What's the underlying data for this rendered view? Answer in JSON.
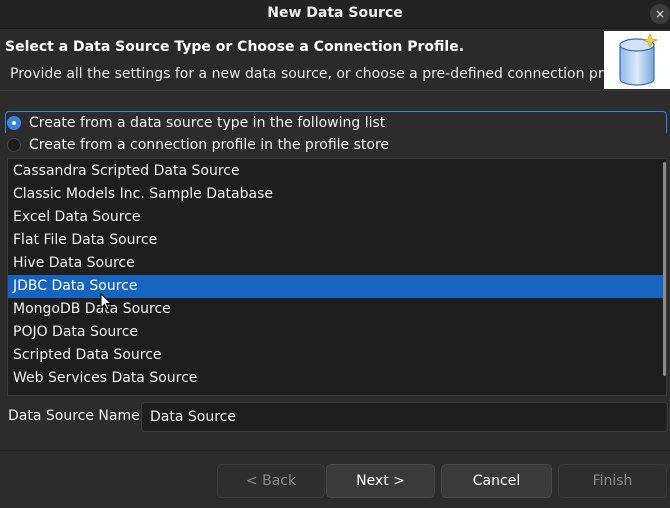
{
  "window": {
    "title": "New Data Source",
    "close_icon": "×"
  },
  "banner": {
    "title": "Select a Data Source Type or Choose a Connection Profile.",
    "description": "Provide all the settings for a new data source, or choose a pre-defined connection profile.",
    "image_icon": "database-wizard-icon"
  },
  "options": [
    {
      "label": "Create from a data source type in the following list",
      "checked": true
    },
    {
      "label": "Create from a connection profile in the profile store",
      "checked": false
    }
  ],
  "data_source_types": [
    {
      "label": "Cassandra Scripted Data Source",
      "selected": false
    },
    {
      "label": "Classic Models Inc. Sample Database",
      "selected": false
    },
    {
      "label": "Excel Data Source",
      "selected": false
    },
    {
      "label": "Flat File Data Source",
      "selected": false
    },
    {
      "label": "Hive Data Source",
      "selected": false
    },
    {
      "label": "JDBC Data Source",
      "selected": true
    },
    {
      "label": "MongoDB Data Source",
      "selected": false
    },
    {
      "label": "POJO Data Source",
      "selected": false
    },
    {
      "label": "Scripted Data Source",
      "selected": false
    },
    {
      "label": "Web Services Data Source",
      "selected": false
    }
  ],
  "name_field": {
    "label": "Data Source Name:",
    "value": "Data Source"
  },
  "buttons": {
    "back": {
      "label": "< Back",
      "enabled": false
    },
    "next": {
      "label": "Next >",
      "enabled": true
    },
    "cancel": {
      "label": "Cancel",
      "enabled": true
    },
    "finish": {
      "label": "Finish",
      "enabled": false
    }
  },
  "colors": {
    "accent": "#3584e4",
    "selection": "#1565c0",
    "window_bg": "#2c2c2c",
    "list_bg": "#1e1e1e"
  }
}
